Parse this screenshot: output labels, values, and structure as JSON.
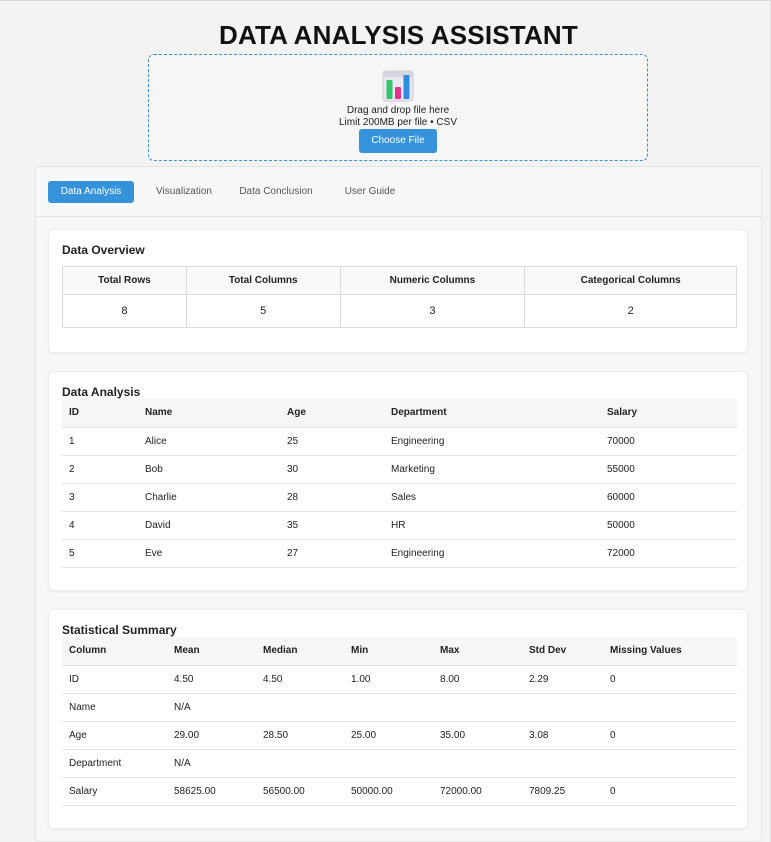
{
  "app": {
    "title": "DATA ANALYSIS ASSISTANT"
  },
  "upload": {
    "icon": "bar-chart-icon",
    "drag_text": "Drag and drop file here",
    "limit_text": "Limit 200MB per file • CSV",
    "button_label": "Choose File"
  },
  "tabs": [
    {
      "label": "Data Analysis",
      "active": true
    },
    {
      "label": "Visualization",
      "active": false
    },
    {
      "label": "Data Conclusion",
      "active": false
    },
    {
      "label": "User Guide",
      "active": false
    }
  ],
  "overview": {
    "title": "Data Overview",
    "headers": [
      "Total Rows",
      "Total Columns",
      "Numeric Columns",
      "Categorical Columns"
    ],
    "values": [
      "8",
      "5",
      "3",
      "2"
    ]
  },
  "analysis": {
    "title": "Data Analysis",
    "headers": [
      "ID",
      "Name",
      "Age",
      "Department",
      "Salary"
    ],
    "rows": [
      [
        "1",
        "Alice",
        "25",
        "Engineering",
        "70000"
      ],
      [
        "2",
        "Bob",
        "30",
        "Marketing",
        "55000"
      ],
      [
        "3",
        "Charlie",
        "28",
        "Sales",
        "60000"
      ],
      [
        "4",
        "David",
        "35",
        "HR",
        "50000"
      ],
      [
        "5",
        "Eve",
        "27",
        "Engineering",
        "72000"
      ]
    ]
  },
  "summary": {
    "title": "Statistical Summary",
    "headers": [
      "Column",
      "Mean",
      "Median",
      "Min",
      "Max",
      "Std Dev",
      "Missing Values"
    ],
    "rows": [
      [
        "ID",
        "4.50",
        "4.50",
        "1.00",
        "8.00",
        "2.29",
        "0"
      ],
      [
        "Name",
        "N/A",
        "",
        "",
        "",
        "",
        ""
      ],
      [
        "Age",
        "29.00",
        "28.50",
        "25.00",
        "35.00",
        "3.08",
        "0"
      ],
      [
        "Department",
        "N/A",
        "",
        "",
        "",
        "",
        ""
      ],
      [
        "Salary",
        "58625.00",
        "56500.00",
        "50000.00",
        "72000.00",
        "7809.25",
        "0"
      ]
    ]
  },
  "colors": {
    "accent": "#3592db",
    "page_bg": "#f3f3f3",
    "card_bg": "#ffffff"
  }
}
